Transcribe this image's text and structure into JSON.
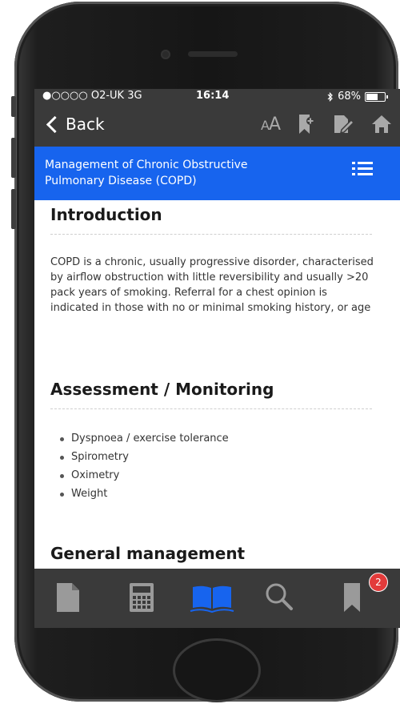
{
  "status_bar": {
    "carrier": "●○○○○ O2-UK  3G",
    "time": "16:14",
    "bluetooth_icon": "bluetooth-icon",
    "battery_text": "68%",
    "battery_level": 0.68
  },
  "nav": {
    "back_label": "Back",
    "font_size_small": "A",
    "font_size_large": "A",
    "icons": [
      "font-size-icon",
      "bookmark-add-icon",
      "note-edit-icon",
      "home-icon"
    ]
  },
  "header": {
    "title": "Management of Chronic Obstructive Pulmonary Disease (COPD)",
    "menu_icon": "list-menu-icon",
    "color": "#1764ee"
  },
  "sections": {
    "intro_title": "Introduction",
    "intro_text": "COPD is a chronic, usually progressive disorder, characterised by airflow obstruction with little reversibility and usually >20 pack years of smoking. Referral for a chest opinion is indicated in those with no or minimal smoking history, or age",
    "assessment_title": "Assessment / Monitoring",
    "assessment_items": [
      "Dyspnoea / exercise tolerance",
      "Spirometry",
      "Oximetry",
      "Weight"
    ],
    "general_title": "General management"
  },
  "tab_bar": {
    "tabs": [
      "document-icon",
      "calculator-icon",
      "book-icon",
      "search-icon",
      "bookmarks-icon"
    ],
    "active_tab": "book-icon",
    "active_color": "#1764ee",
    "inactive_color": "#9a9a9a",
    "bookmark_badge": "2"
  }
}
